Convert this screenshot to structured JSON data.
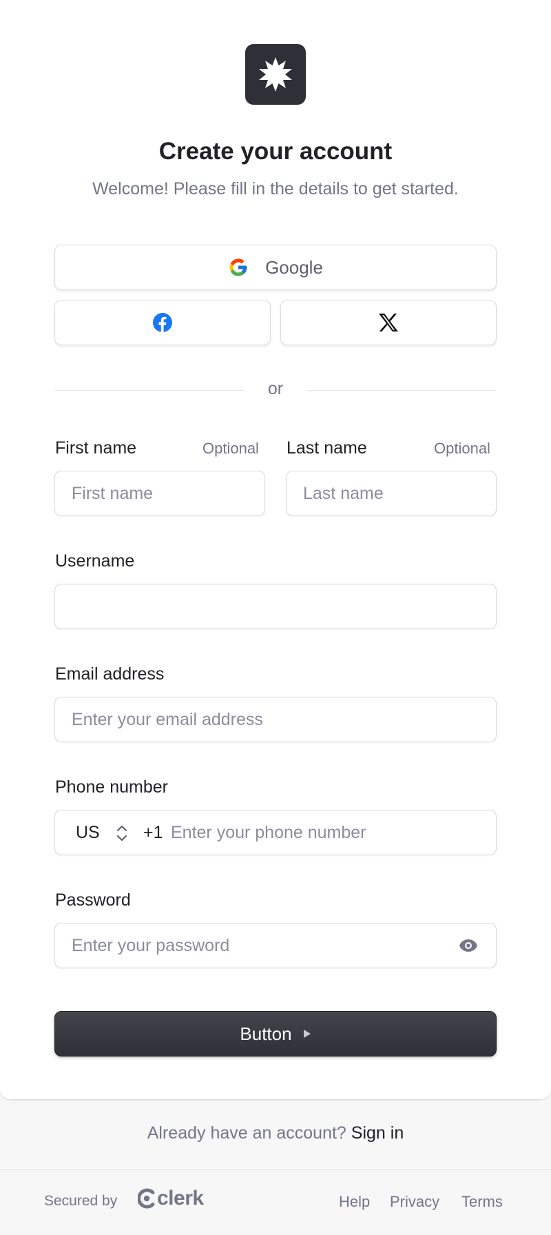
{
  "header": {
    "title": "Create your account",
    "subtitle": "Welcome! Please fill in the details to get started."
  },
  "social": {
    "google_label": "Google",
    "facebook_icon": "facebook-icon",
    "x_icon": "x-icon"
  },
  "divider_text": "or",
  "form": {
    "first_name": {
      "label": "First name",
      "optional": "Optional",
      "placeholder": "First name",
      "value": ""
    },
    "last_name": {
      "label": "Last name",
      "optional": "Optional",
      "placeholder": "Last name",
      "value": ""
    },
    "username": {
      "label": "Username",
      "placeholder": "",
      "value": ""
    },
    "email": {
      "label": "Email address",
      "placeholder": "Enter your email address",
      "value": ""
    },
    "phone": {
      "label": "Phone number",
      "country": "US",
      "dial_code": "+1",
      "placeholder": "Enter your phone number",
      "value": ""
    },
    "password": {
      "label": "Password",
      "placeholder": "Enter your password",
      "value": ""
    },
    "submit_label": "Button"
  },
  "footer": {
    "prompt": "Already have an account?",
    "sign_in_label": "Sign in",
    "secured_by": "Secured by",
    "brand": "clerk",
    "links": [
      "Help",
      "Privacy",
      "Terms"
    ]
  },
  "colors": {
    "primary": "#2f3037",
    "muted_text": "#747686",
    "facebook_blue": "#1877f2"
  }
}
